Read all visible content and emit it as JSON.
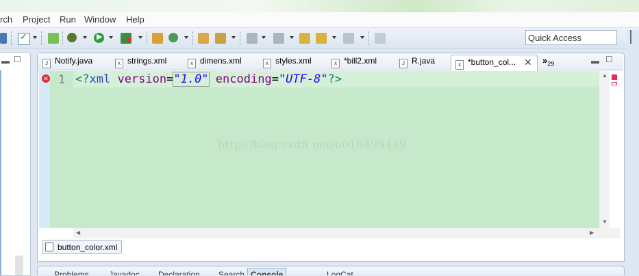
{
  "menubar": {
    "items": [
      "rch",
      "Project",
      "Run",
      "Window",
      "Help"
    ]
  },
  "toolbar": {
    "quick_access_placeholder": "Quick Access",
    "buttons": [
      "toggle-icon",
      "save-icon",
      "debug-icon",
      "run-icon",
      "external-tools-icon",
      "new-project-icon",
      "refresh-icon",
      "open-type-icon",
      "search-icon",
      "back-icon",
      "forward-icon",
      "pin-icon"
    ]
  },
  "editor": {
    "tabs": [
      {
        "label": "Notify.java",
        "type": "J"
      },
      {
        "label": "strings.xml",
        "type": "x"
      },
      {
        "label": "dimens.xml",
        "type": "x"
      },
      {
        "label": "styles.xml",
        "type": "x"
      },
      {
        "label": "*bill2.xml",
        "type": "x"
      },
      {
        "label": "R.java",
        "type": "J"
      },
      {
        "label": "*button_col...",
        "type": "x",
        "active": true
      }
    ],
    "overflow_label": "»",
    "overflow_count": "29",
    "line_number": "1",
    "code": {
      "open": "<?",
      "tag": "xml",
      "attr1": "version",
      "eq1": "=",
      "val1": "\"1.0\"",
      "attr2": "encoding",
      "eq2": "=",
      "val2": "\"UTF-8\"",
      "close": "?>"
    },
    "watermark": "http://blog.csdn.net/u010499449",
    "bottom_tab": "button_color.xml"
  },
  "lower_panel": {
    "tabs": [
      "Problems",
      "Javadoc",
      "Declaration",
      "Search",
      "Console",
      "LogCat"
    ]
  },
  "colors": {
    "editor_bg": "#c7e9cb",
    "accent": "#3f3fbf"
  }
}
